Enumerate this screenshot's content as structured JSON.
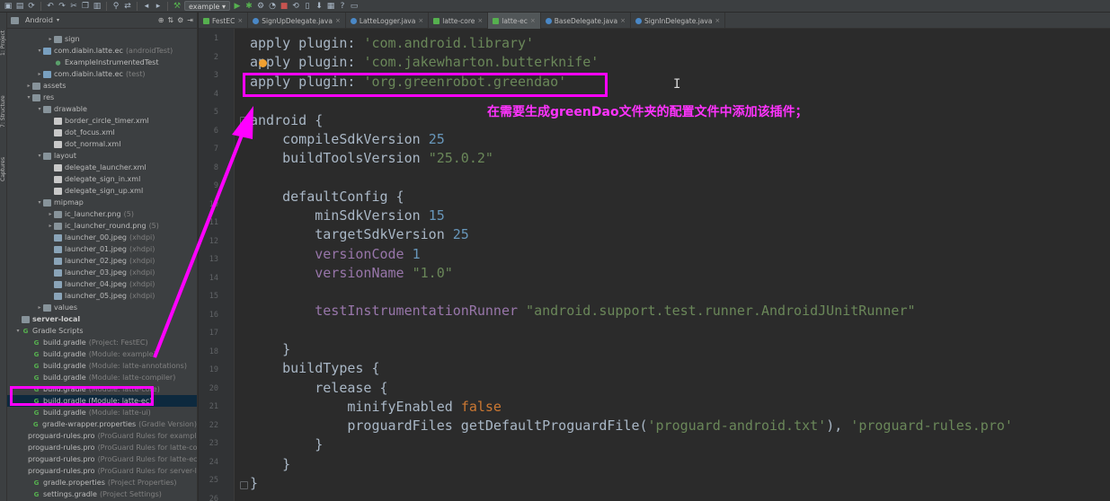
{
  "toolbar": {
    "run_config": "example",
    "icons": [
      "open-icon",
      "save-icon",
      "sync-icon",
      "undo-icon",
      "redo-icon",
      "cut-icon",
      "copy-icon",
      "paste-icon",
      "find-icon",
      "replace-icon",
      "back-icon",
      "forward-icon",
      "build-icon",
      "run-icon",
      "debug-icon",
      "attach-icon",
      "profile-icon",
      "stop-icon",
      "sync-gradle-icon",
      "avd-icon",
      "sdk-icon",
      "structure-icon",
      "help-icon",
      "device-icon"
    ]
  },
  "tool_strip": {
    "tabs": [
      "1: Project",
      "7: Structure",
      "Captures"
    ]
  },
  "project_panel": {
    "view_mode": "Android",
    "rows": [
      {
        "indent": 2,
        "arrow": "▸",
        "icon": "folder",
        "label": "sign",
        "hint": ""
      },
      {
        "indent": 1,
        "arrow": "▾",
        "icon": "pkg",
        "label": "com.diabin.latte.ec",
        "hint": "(androidTest)"
      },
      {
        "indent": 2,
        "arrow": "",
        "icon": "test",
        "label": "ExampleInstrumentedTest",
        "hint": ""
      },
      {
        "indent": 1,
        "arrow": "▸",
        "icon": "pkg",
        "label": "com.diabin.latte.ec",
        "hint": "(test)"
      },
      {
        "indent": 0,
        "arrow": "▸",
        "icon": "folder",
        "label": "assets",
        "hint": ""
      },
      {
        "indent": 0,
        "arrow": "▾",
        "icon": "folder",
        "label": "res",
        "hint": ""
      },
      {
        "indent": 1,
        "arrow": "▾",
        "icon": "folder",
        "label": "drawable",
        "hint": ""
      },
      {
        "indent": 2,
        "arrow": "",
        "icon": "xml",
        "label": "border_circle_timer.xml",
        "hint": ""
      },
      {
        "indent": 2,
        "arrow": "",
        "icon": "xml",
        "label": "dot_focus.xml",
        "hint": ""
      },
      {
        "indent": 2,
        "arrow": "",
        "icon": "xml",
        "label": "dot_normal.xml",
        "hint": ""
      },
      {
        "indent": 1,
        "arrow": "▾",
        "icon": "folder",
        "label": "layout",
        "hint": ""
      },
      {
        "indent": 2,
        "arrow": "",
        "icon": "xml",
        "label": "delegate_launcher.xml",
        "hint": ""
      },
      {
        "indent": 2,
        "arrow": "",
        "icon": "xml",
        "label": "delegate_sign_in.xml",
        "hint": ""
      },
      {
        "indent": 2,
        "arrow": "",
        "icon": "xml",
        "label": "delegate_sign_up.xml",
        "hint": ""
      },
      {
        "indent": 1,
        "arrow": "▾",
        "icon": "folder",
        "label": "mipmap",
        "hint": ""
      },
      {
        "indent": 2,
        "arrow": "▸",
        "icon": "folder",
        "label": "ic_launcher.png",
        "hint": "(5)"
      },
      {
        "indent": 2,
        "arrow": "▸",
        "icon": "folder",
        "label": "ic_launcher_round.png",
        "hint": "(5)"
      },
      {
        "indent": 2,
        "arrow": "",
        "icon": "img",
        "label": "launcher_00.jpeg",
        "hint": "(xhdpi)"
      },
      {
        "indent": 2,
        "arrow": "",
        "icon": "img",
        "label": "launcher_01.jpeg",
        "hint": "(xhdpi)"
      },
      {
        "indent": 2,
        "arrow": "",
        "icon": "img",
        "label": "launcher_02.jpeg",
        "hint": "(xhdpi)"
      },
      {
        "indent": 2,
        "arrow": "",
        "icon": "img",
        "label": "launcher_03.jpeg",
        "hint": "(xhdpi)"
      },
      {
        "indent": 2,
        "arrow": "",
        "icon": "img",
        "label": "launcher_04.jpeg",
        "hint": "(xhdpi)"
      },
      {
        "indent": 2,
        "arrow": "",
        "icon": "img",
        "label": "launcher_05.jpeg",
        "hint": "(xhdpi)"
      },
      {
        "indent": 1,
        "arrow": "▸",
        "icon": "folder",
        "label": "values",
        "hint": ""
      },
      {
        "indent": -1,
        "arrow": "",
        "icon": "folder",
        "label": "server-local",
        "hint": "",
        "bold": true
      },
      {
        "indent": -1,
        "arrow": "▾",
        "icon": "gradle",
        "label": "Gradle Scripts",
        "hint": ""
      },
      {
        "indent": 0,
        "arrow": "",
        "icon": "gradle",
        "label": "build.gradle",
        "hint": "(Project: FestEC)"
      },
      {
        "indent": 0,
        "arrow": "",
        "icon": "gradle",
        "label": "build.gradle",
        "hint": "(Module: example)"
      },
      {
        "indent": 0,
        "arrow": "",
        "icon": "gradle",
        "label": "build.gradle",
        "hint": "(Module: latte-annotations)"
      },
      {
        "indent": 0,
        "arrow": "",
        "icon": "gradle",
        "label": "build.gradle",
        "hint": "(Module: latte-compiler)"
      },
      {
        "indent": 0,
        "arrow": "",
        "icon": "gradle",
        "label": "build.gradle",
        "hint": "(Module: latte-core)"
      },
      {
        "indent": 0,
        "arrow": "",
        "icon": "gradle",
        "label": "build.gradle (Module: latte-ec)",
        "hint": "",
        "selected": true
      },
      {
        "indent": 0,
        "arrow": "",
        "icon": "gradle",
        "label": "build.gradle",
        "hint": "(Module: latte-ui)"
      },
      {
        "indent": 0,
        "arrow": "",
        "icon": "gradle",
        "label": "gradle-wrapper.properties",
        "hint": "(Gradle Version)"
      },
      {
        "indent": 0,
        "arrow": "",
        "icon": "xml",
        "label": "proguard-rules.pro",
        "hint": "(ProGuard Rules for example)"
      },
      {
        "indent": 0,
        "arrow": "",
        "icon": "xml",
        "label": "proguard-rules.pro",
        "hint": "(ProGuard Rules for latte-core)"
      },
      {
        "indent": 0,
        "arrow": "",
        "icon": "xml",
        "label": "proguard-rules.pro",
        "hint": "(ProGuard Rules for latte-ec)"
      },
      {
        "indent": 0,
        "arrow": "",
        "icon": "xml",
        "label": "proguard-rules.pro",
        "hint": "(ProGuard Rules for server-local)"
      },
      {
        "indent": 0,
        "arrow": "",
        "icon": "gradle",
        "label": "gradle.properties",
        "hint": "(Project Properties)"
      },
      {
        "indent": 0,
        "arrow": "",
        "icon": "gradle",
        "label": "settings.gradle",
        "hint": "(Project Settings)"
      },
      {
        "indent": 0,
        "arrow": "",
        "icon": "xml",
        "label": "local.properties",
        "hint": "(SDK Location)"
      }
    ]
  },
  "editor_tabs": [
    {
      "label": "FestEC",
      "type": "mod",
      "active": false
    },
    {
      "label": "SignUpDelegate.java",
      "type": "class",
      "active": false
    },
    {
      "label": "LatteLogger.java",
      "type": "class",
      "active": false
    },
    {
      "label": "latte-core",
      "type": "mod",
      "active": false
    },
    {
      "label": "latte-ec",
      "type": "mod",
      "active": true
    },
    {
      "label": "BaseDelegate.java",
      "type": "class",
      "active": false
    },
    {
      "label": "SignInDelegate.java",
      "type": "class",
      "active": false
    }
  ],
  "line_numbers": [
    "1",
    "2",
    "3",
    "4",
    "5",
    "6",
    "7",
    "8",
    "9",
    "10",
    "11",
    "12",
    "13",
    "14",
    "15",
    "16",
    "17",
    "18",
    "19",
    "20",
    "21",
    "22",
    "23",
    "24",
    "25",
    "26"
  ],
  "code_lines": [
    [
      {
        "t": "apply plugin: ",
        "c": ""
      },
      {
        "t": "'com.android.library'",
        "c": "str"
      }
    ],
    [
      {
        "t": "apply plugin: ",
        "c": ""
      },
      {
        "t": "'com.jakewharton.butterknife'",
        "c": "str"
      }
    ],
    [
      {
        "t": "apply plugin: ",
        "c": ""
      },
      {
        "t": "'org.greenrobot.greendao'",
        "c": "str"
      }
    ],
    [],
    [
      {
        "t": "android {",
        "c": ""
      }
    ],
    [
      {
        "t": "    compileSdkVersion ",
        "c": ""
      },
      {
        "t": "25",
        "c": "num"
      }
    ],
    [
      {
        "t": "    buildToolsVersion ",
        "c": ""
      },
      {
        "t": "\"25.0.2\"",
        "c": "str"
      }
    ],
    [],
    [
      {
        "t": "    defaultConfig {",
        "c": ""
      }
    ],
    [
      {
        "t": "        minSdkVersion ",
        "c": ""
      },
      {
        "t": "15",
        "c": "num"
      }
    ],
    [
      {
        "t": "        targetSdkVersion ",
        "c": ""
      },
      {
        "t": "25",
        "c": "num"
      }
    ],
    [
      {
        "t": "        versionCode ",
        "c": "prop"
      },
      {
        "t": "1",
        "c": "num"
      }
    ],
    [
      {
        "t": "        versionName ",
        "c": "prop"
      },
      {
        "t": "\"1.0\"",
        "c": "str"
      }
    ],
    [],
    [
      {
        "t": "        testInstrumentationRunner ",
        "c": "prop"
      },
      {
        "t": "\"android.support.test.runner.AndroidJUnitRunner\"",
        "c": "str"
      }
    ],
    [],
    [
      {
        "t": "    }",
        "c": ""
      }
    ],
    [
      {
        "t": "    buildTypes {",
        "c": ""
      }
    ],
    [
      {
        "t": "        release {",
        "c": ""
      }
    ],
    [
      {
        "t": "            minifyEnabled ",
        "c": ""
      },
      {
        "t": "false",
        "c": "kw"
      }
    ],
    [
      {
        "t": "            proguardFiles getDefaultProguardFile(",
        "c": ""
      },
      {
        "t": "'proguard-android.txt'",
        "c": "str"
      },
      {
        "t": "), ",
        "c": ""
      },
      {
        "t": "'proguard-rules.pro'",
        "c": "str"
      }
    ],
    [
      {
        "t": "        }",
        "c": ""
      }
    ],
    [
      {
        "t": "    }",
        "c": ""
      }
    ],
    [
      {
        "t": "}",
        "c": ""
      }
    ]
  ],
  "annotation": {
    "text": "在需要生成greenDao文件夹的配置文件中添加该插件；",
    "color": "#ff00ff"
  },
  "colors": {
    "editor_bg": "#2b2b2b",
    "panel_bg": "#3c3f41",
    "string": "#6a8759",
    "keyword": "#cc7832",
    "number": "#6897bb",
    "property": "#9876aa"
  }
}
